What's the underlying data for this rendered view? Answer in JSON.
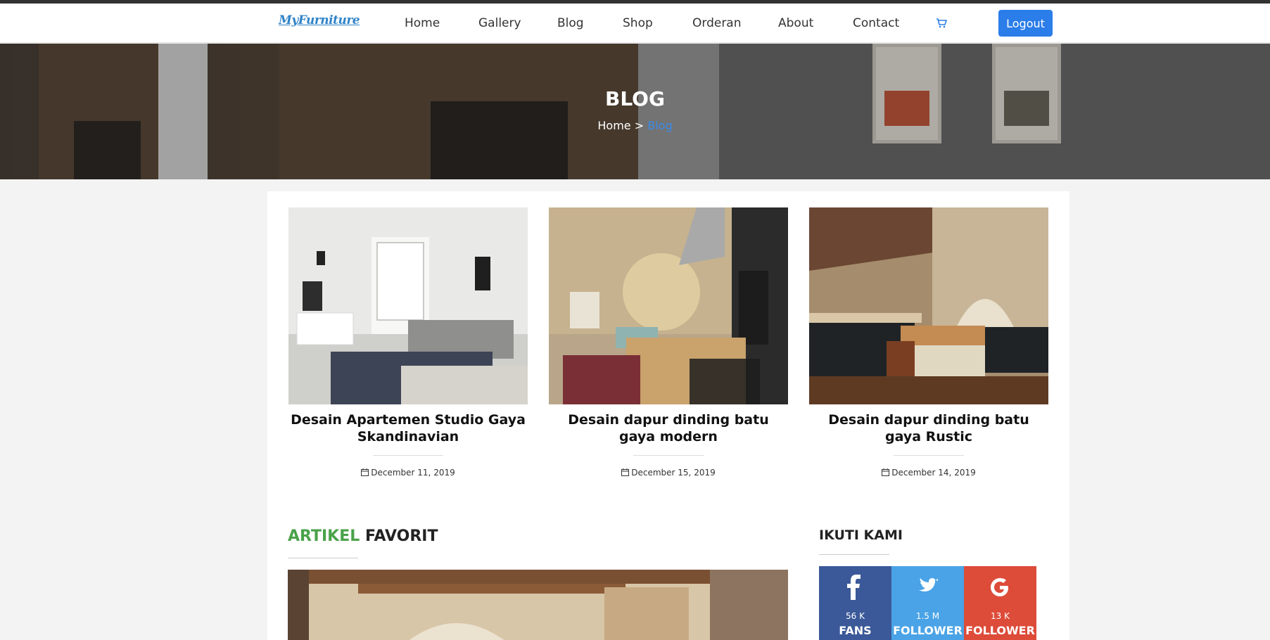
{
  "brand": {
    "logo_text": "MyFurniture"
  },
  "nav": {
    "items": [
      "Home",
      "Gallery",
      "Blog",
      "Shop",
      "Orderan",
      "About",
      "Contact"
    ],
    "cart_icon": "cart-icon",
    "logout_label": "Logout"
  },
  "hero": {
    "title": "BLOG",
    "breadcrumb_home": "Home",
    "breadcrumb_separator": ">",
    "breadcrumb_current": "Blog"
  },
  "posts": [
    {
      "title": "Desain Apartemen Studio Gaya Skandinavian",
      "date": "December 11, 2019",
      "date_icon": "calendar-icon"
    },
    {
      "title": "Desain dapur dinding batu gaya modern",
      "date": "December 15, 2019",
      "date_icon": "calendar-icon"
    },
    {
      "title": "Desain dapur dinding batu gaya Rustic",
      "date": "December 14, 2019",
      "date_icon": "calendar-icon"
    }
  ],
  "favorites": {
    "heading_accent": "ARTIKEL",
    "heading_rest": "FAVORIT"
  },
  "follow": {
    "heading": "IKUTI KAMI",
    "networks": [
      {
        "icon": "facebook-icon",
        "count": "56 K",
        "label": "FANS",
        "color": "#3b5998"
      },
      {
        "icon": "twitter-icon",
        "count": "1.5 M",
        "label": "FOLLOWER",
        "color": "#4aa3e6"
      },
      {
        "icon": "google-icon",
        "count": "13 K",
        "label": "FOLLOWER",
        "color": "#dd4b39"
      }
    ]
  },
  "colors": {
    "accent_blue": "#2b7de9",
    "accent_green": "#4aa24a",
    "page_bg": "#f3f3f3"
  }
}
